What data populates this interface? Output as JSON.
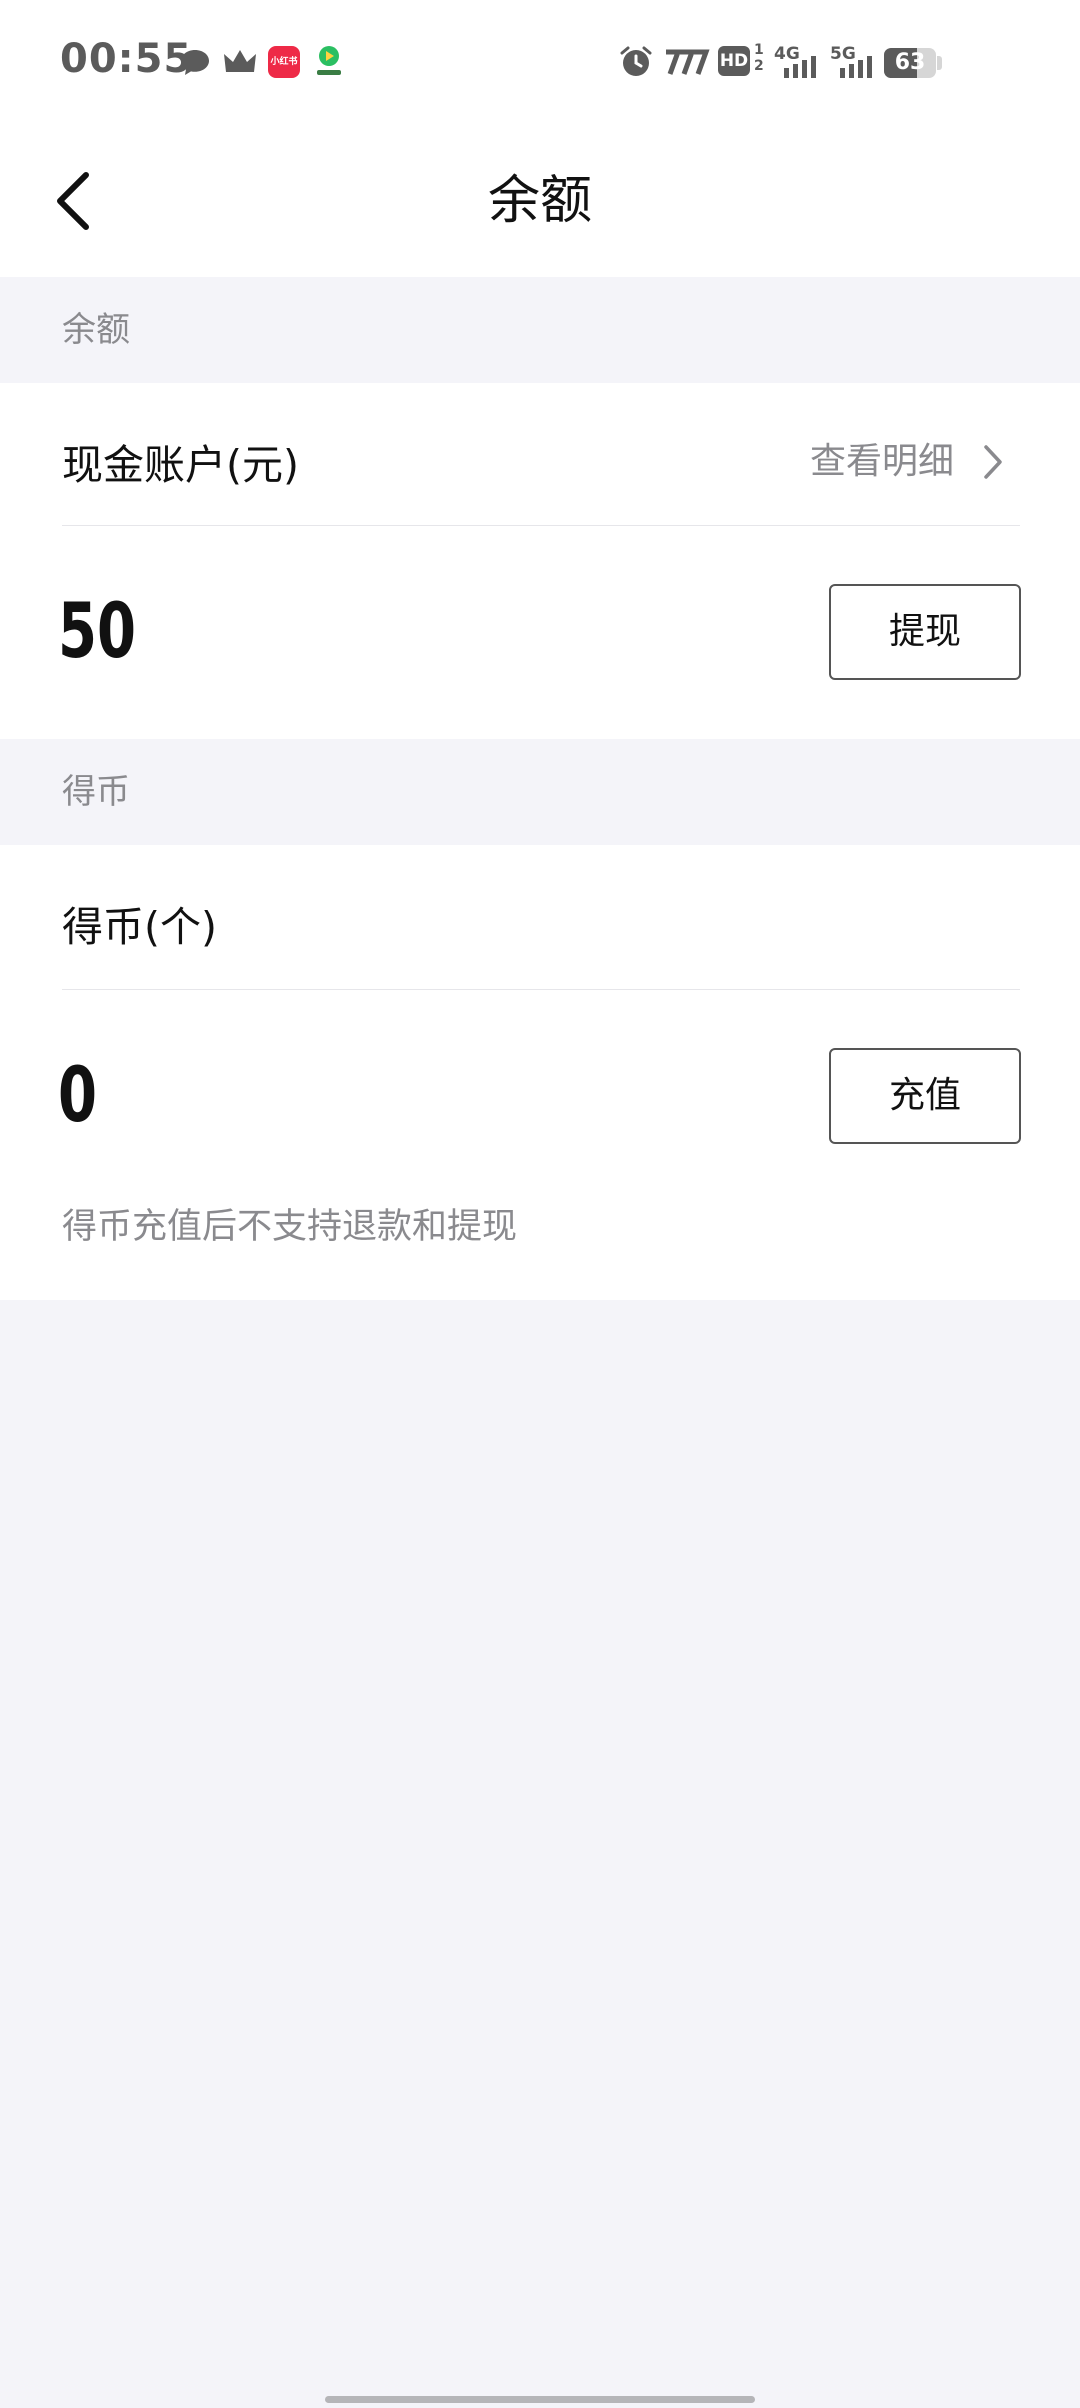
{
  "status_bar": {
    "time": "00:55",
    "left_icons": [
      "chat-bubble-icon",
      "crown-icon",
      "red-app-icon",
      "green-play-app-icon"
    ],
    "red_app_text": "小红书",
    "right_icons": [
      "alarm-icon",
      "network-speed-icon",
      "hd-voice-icon",
      "signal-4g-icon",
      "signal-5g-icon",
      "battery-icon"
    ],
    "hd_label": "HD",
    "hd_sub": "1\n2",
    "net_4g": "4G",
    "net_5g": "5G",
    "battery_level": "63",
    "battery_fraction": 0.63
  },
  "nav": {
    "back_icon": "chevron-left-icon",
    "title": "余额"
  },
  "balance_section": {
    "header": "余额",
    "account_title": "现金账户(元)",
    "detail_link": "查看明细",
    "amount": "50",
    "action": "提现"
  },
  "coin_section": {
    "header": "得币",
    "account_title": "得币(个)",
    "amount": "0",
    "action": "充值",
    "notice": "得币充值后不支持退款和提现"
  },
  "colors": {
    "background": "#f4f4f9",
    "card": "#ffffff",
    "secondary_text": "#8a8a8e",
    "primary_text": "#111111"
  }
}
